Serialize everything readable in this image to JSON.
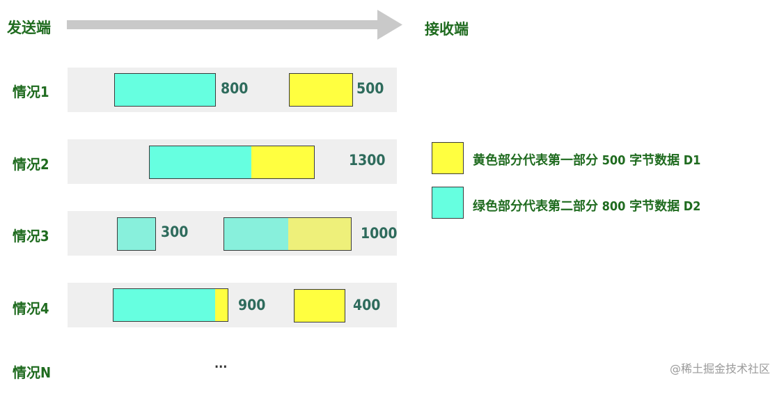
{
  "header": {
    "sender": "发送端",
    "receiver": "接收端"
  },
  "cases": [
    {
      "label": "情况1",
      "values": [
        "800",
        "500"
      ]
    },
    {
      "label": "情况2",
      "values": [
        "1300"
      ]
    },
    {
      "label": "情况3",
      "values": [
        "300",
        "1000"
      ]
    },
    {
      "label": "情况4",
      "values": [
        "900",
        "400"
      ]
    },
    {
      "label": "情况N",
      "values": [
        "..."
      ]
    }
  ],
  "legend": [
    {
      "text": "黄色部分代表第一部分 500 字节数据 D1",
      "color": "#ffff40"
    },
    {
      "text": "绿色部分代表第二部分 800 字节数据 D2",
      "color": "#66ffe0"
    }
  ],
  "watermark": "@稀土掘金技术社区"
}
